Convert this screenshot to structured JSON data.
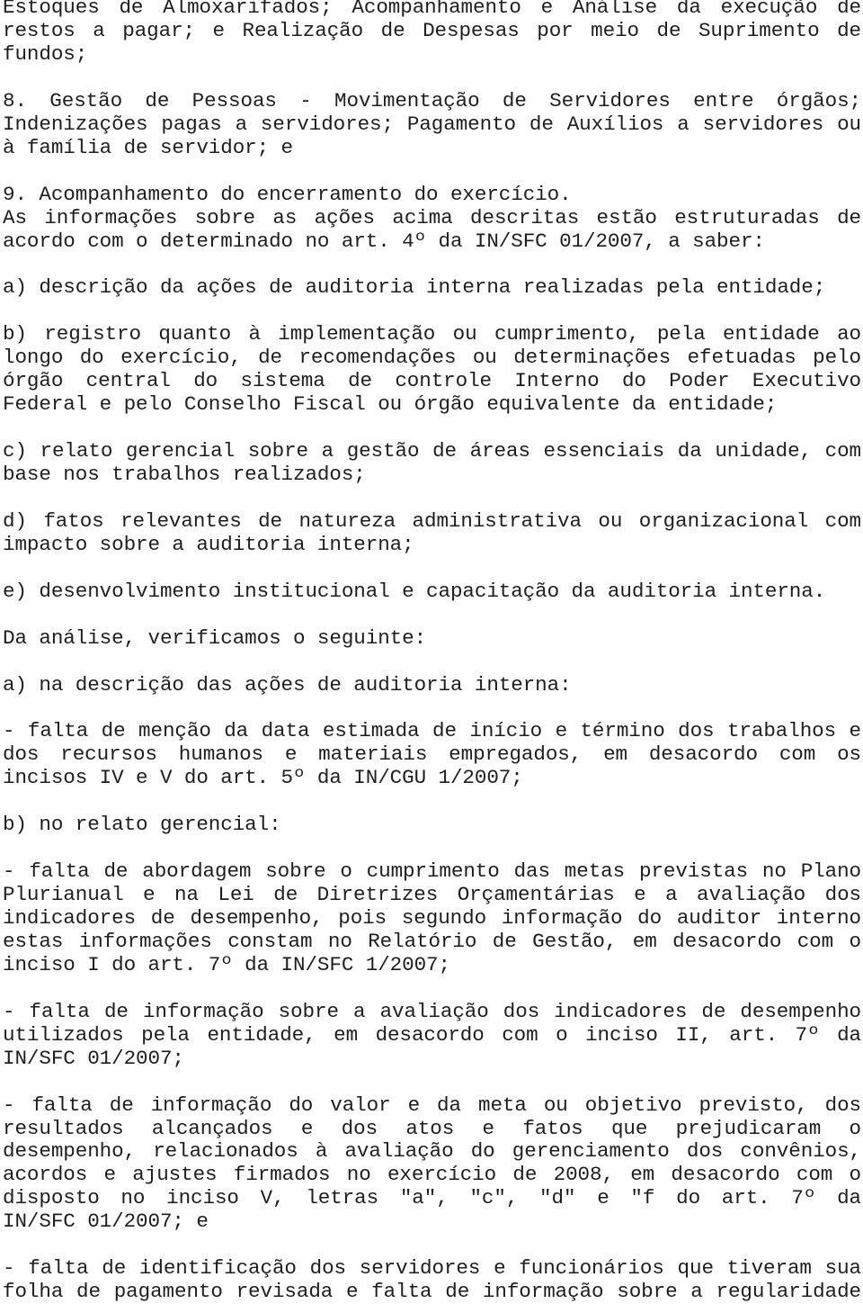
{
  "document": {
    "paragraphs": [
      {
        "lines": [
          "Estoques de Almoxarifados; Acompanhamento e Análise da execução de",
          "restos a pagar; e Realização de Despesas por meio de Suprimento de",
          "fundos;"
        ]
      },
      {
        "lines": [
          "8. Gestão de Pessoas - Movimentação de Servidores entre órgãos;",
          "Indenizações pagas a servidores; Pagamento de Auxílios a servidores ou",
          "à família de servidor; e"
        ]
      },
      {
        "lines": [
          "9. Acompanhamento do encerramento do exercício.",
          "As informações sobre as ações acima descritas estão estruturadas de",
          "acordo com o determinado no art. 4º da IN/SFC 01/2007, a saber:"
        ]
      },
      {
        "lines": [
          "a) descrição da ações de auditoria interna realizadas pela entidade;"
        ]
      },
      {
        "lines": [
          "b) registro quanto à implementação ou cumprimento, pela entidade ao",
          "longo do exercício, de recomendações ou determinações efetuadas pelo",
          "órgão central do sistema de controle Interno do Poder Executivo",
          "Federal e pelo Conselho Fiscal ou órgão equivalente da entidade;"
        ]
      },
      {
        "lines": [
          "c) relato gerencial sobre a gestão de áreas essenciais da unidade, com",
          "base nos trabalhos realizados;"
        ]
      },
      {
        "lines": [
          "d) fatos relevantes de natureza administrativa ou organizacional com",
          "impacto sobre a auditoria interna;"
        ]
      },
      {
        "lines": [
          "e) desenvolvimento institucional e capacitação da auditoria interna."
        ]
      },
      {
        "lines": [
          "Da análise, verificamos o seguinte:"
        ]
      },
      {
        "lines": [
          "a) na descrição das ações de auditoria interna:"
        ]
      },
      {
        "lines": [
          "- falta de menção da data estimada de início e término dos trabalhos e",
          "dos recursos humanos e materiais empregados, em desacordo com os",
          "incisos IV e V do art. 5º da IN/CGU 1/2007;"
        ]
      },
      {
        "lines": [
          "b) no relato gerencial:"
        ]
      },
      {
        "lines": [
          "- falta de abordagem sobre o cumprimento das metas previstas no Plano",
          "Plurianual e na Lei de Diretrizes Orçamentárias e a avaliação dos",
          "indicadores de desempenho, pois segundo informação do auditor interno",
          "estas informações constam no Relatório de Gestão, em desacordo com o",
          "inciso I do art. 7º da IN/SFC 1/2007;"
        ]
      },
      {
        "lines": [
          "- falta de informação sobre a avaliação dos indicadores de desempenho",
          "utilizados pela entidade, em desacordo com o inciso II, art. 7º da",
          "IN/SFC 01/2007;"
        ]
      },
      {
        "lines": [
          "- falta de informação do valor e da meta ou objetivo previsto, dos",
          "resultados alcançados e dos atos e fatos que prejudicaram o",
          "desempenho, relacionados à avaliação do gerenciamento dos convênios,",
          "acordos e ajustes firmados no exercício de 2008, em desacordo com o",
          "disposto no inciso V, letras \"a\", \"c\", \"d\" e \"f do art. 7º da",
          "IN/SFC 01/2007; e"
        ]
      },
      {
        "lines": [
          "- falta de identificação dos servidores e funcionários que tiveram sua",
          "folha de pagamento revisada e falta de informação sobre a regularidade"
        ]
      }
    ]
  }
}
